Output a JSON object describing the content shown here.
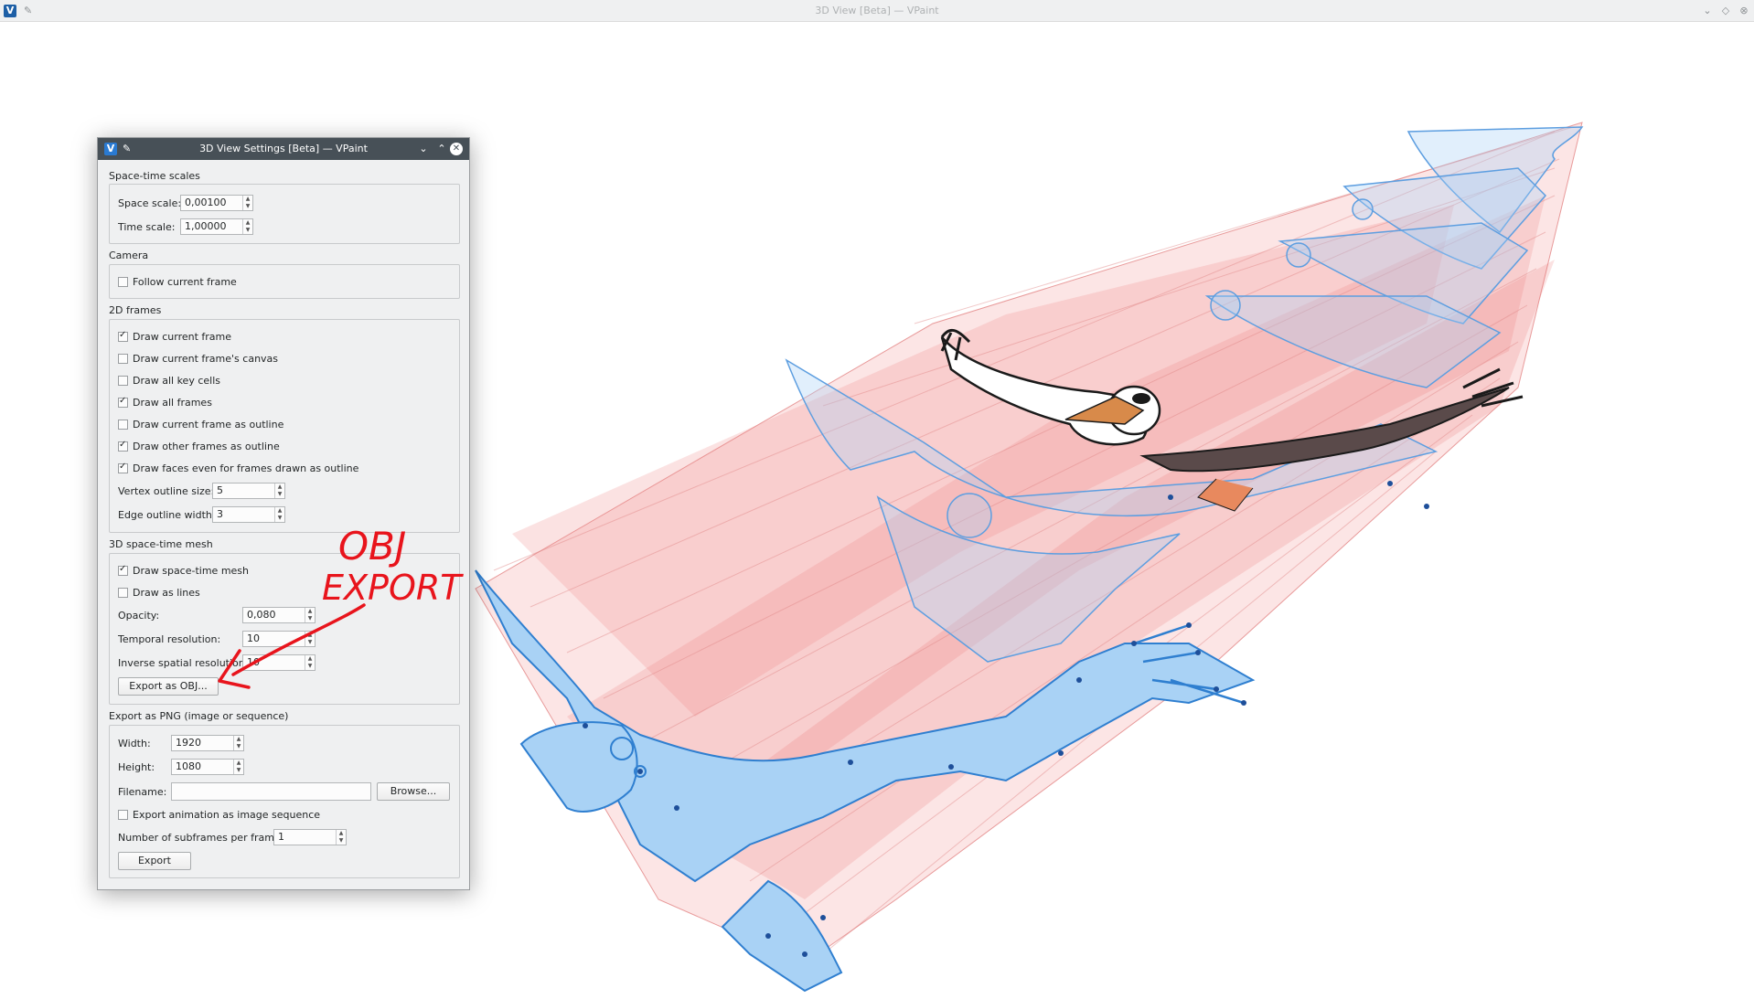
{
  "main_window": {
    "title": "3D View [Beta] — VPaint",
    "app_icon": "V"
  },
  "dialog": {
    "title": "3D View Settings [Beta] — VPaint",
    "app_icon": "V",
    "space_time_scales": {
      "title": "Space-time scales",
      "space_scale_label": "Space scale:",
      "space_scale_value": "0,00100",
      "time_scale_label": "Time scale:",
      "time_scale_value": "1,00000"
    },
    "camera": {
      "title": "Camera",
      "follow_current_frame": {
        "label": "Follow current frame",
        "checked": false
      }
    },
    "frames_2d": {
      "title": "2D frames",
      "checkboxes": [
        {
          "label": "Draw current frame",
          "checked": true
        },
        {
          "label": "Draw current frame's canvas",
          "checked": false
        },
        {
          "label": "Draw all key cells",
          "checked": false
        },
        {
          "label": "Draw all frames",
          "checked": true
        },
        {
          "label": "Draw current frame as outline",
          "checked": false
        },
        {
          "label": "Draw other frames as outline",
          "checked": true
        },
        {
          "label": "Draw faces even for frames drawn as outline",
          "checked": true
        }
      ],
      "vertex_outline_size_label": "Vertex outline size:",
      "vertex_outline_size_value": "5",
      "edge_outline_width_label": "Edge outline width:",
      "edge_outline_width_value": "3"
    },
    "mesh_3d": {
      "title": "3D space-time mesh",
      "draw_mesh": {
        "label": "Draw space-time mesh",
        "checked": true
      },
      "draw_as_lines": {
        "label": "Draw as lines",
        "checked": false
      },
      "opacity_label": "Opacity:",
      "opacity_value": "0,080",
      "temporal_resolution_label": "Temporal resolution:",
      "temporal_resolution_value": "10",
      "inverse_spatial_resolution_label": "Inverse spatial resolution:",
      "inverse_spatial_resolution_value": "10",
      "export_obj_label": "Export as OBJ..."
    },
    "export_png": {
      "title": "Export as PNG (image or sequence)",
      "width_label": "Width:",
      "width_value": "1920",
      "height_label": "Height:",
      "height_value": "1080",
      "filename_label": "Filename:",
      "filename_value": "",
      "browse_label": "Browse...",
      "export_sequence": {
        "label": "Export animation as image sequence",
        "checked": false
      },
      "subframes_label": "Number of subframes per frame:",
      "subframes_value": "1",
      "export_label": "Export"
    }
  },
  "annotation": {
    "line1": "OBJ",
    "line2": "EXPORT",
    "color": "#e8141c"
  },
  "colors": {
    "mesh_red": "#f08080",
    "frame_blue": "#a9d2f5",
    "frame_stroke": "#2f7fd0"
  }
}
